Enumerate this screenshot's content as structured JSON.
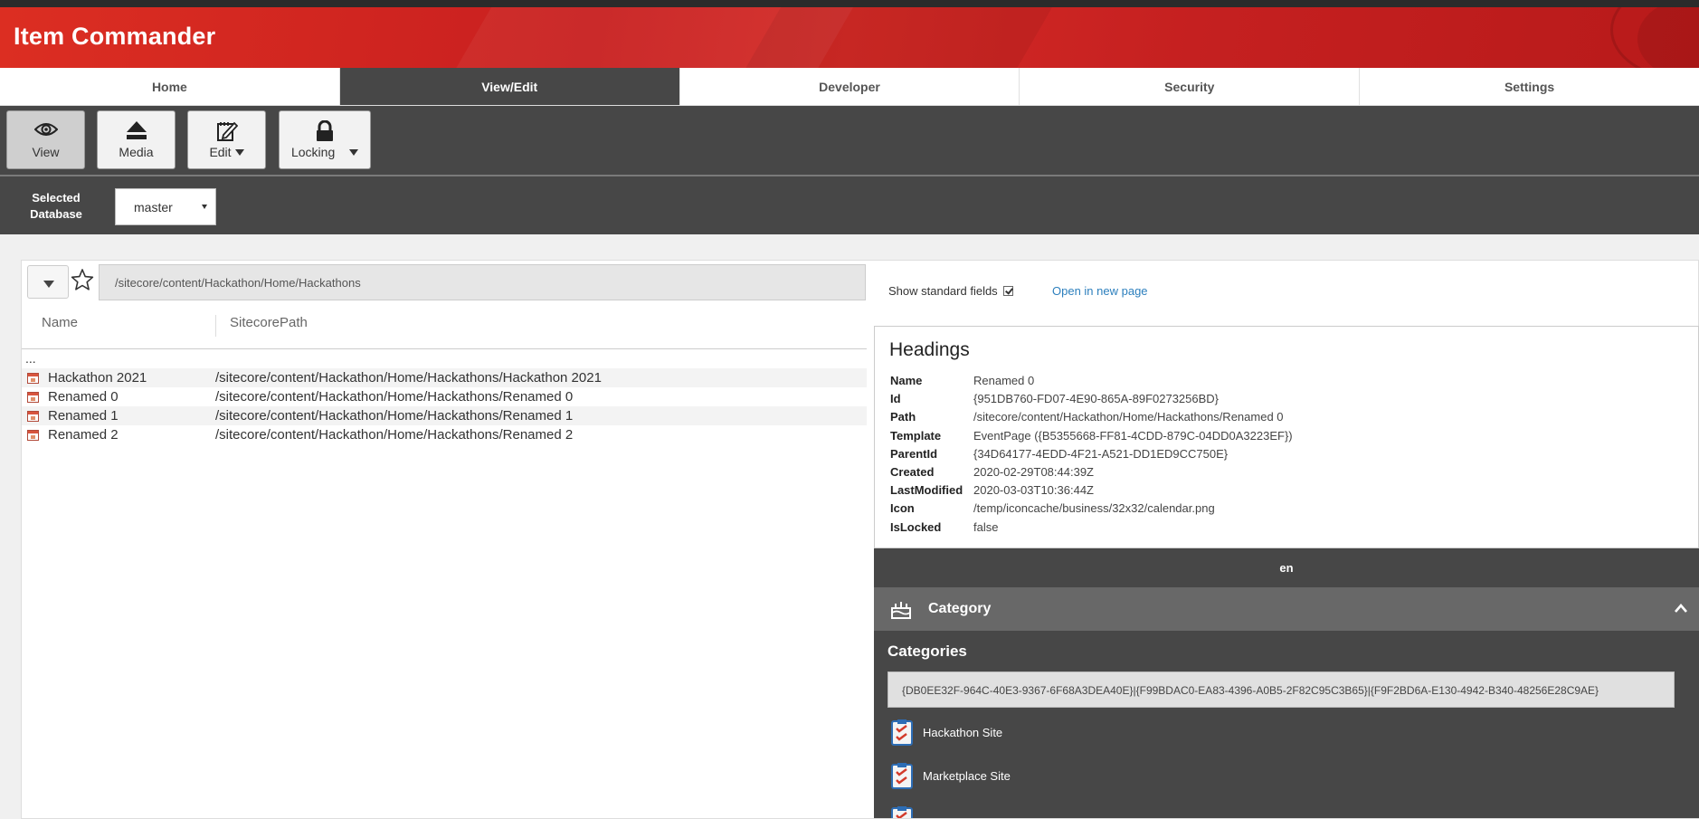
{
  "app": {
    "title": "Item Commander"
  },
  "tabs": [
    {
      "label": "Home"
    },
    {
      "label": "View/Edit"
    },
    {
      "label": "Developer"
    },
    {
      "label": "Security"
    },
    {
      "label": "Settings"
    }
  ],
  "active_tab": "View/Edit",
  "toolbar": {
    "view_label": "View",
    "media_label": "Media",
    "edit_label": "Edit",
    "locking_label": "Locking"
  },
  "database": {
    "label_line1": "Selected",
    "label_line2": "Database",
    "selected": "master"
  },
  "navigator": {
    "path": "/sitecore/content/Hackathon/Home/Hackathons",
    "columns": {
      "name": "Name",
      "path": "SitecorePath"
    },
    "parent_marker": "...",
    "items": [
      {
        "name": "Hackathon 2021",
        "path": "/sitecore/content/Hackathon/Home/Hackathons/Hackathon 2021"
      },
      {
        "name": "Renamed 0",
        "path": "/sitecore/content/Hackathon/Home/Hackathons/Renamed 0"
      },
      {
        "name": "Renamed 1",
        "path": "/sitecore/content/Hackathon/Home/Hackathons/Renamed 1"
      },
      {
        "name": "Renamed 2",
        "path": "/sitecore/content/Hackathon/Home/Hackathons/Renamed 2"
      }
    ]
  },
  "details": {
    "show_standard_fields_label": "Show standard fields",
    "show_standard_fields": true,
    "open_new_page": "Open in new page",
    "headings_title": "Headings",
    "properties": [
      {
        "key": "Name",
        "value": "Renamed 0"
      },
      {
        "key": "Id",
        "value": "{951DB760-FD07-4E90-865A-89F0273256BD}"
      },
      {
        "key": "Path",
        "value": "/sitecore/content/Hackathon/Home/Hackathons/Renamed 0"
      },
      {
        "key": "Template",
        "value": "EventPage ({B5355668-FF81-4CDD-879C-04DD0A3223EF})"
      },
      {
        "key": "ParentId",
        "value": "{34D64177-4EDD-4F21-A521-DD1ED9CC750E}"
      },
      {
        "key": "Created",
        "value": "2020-02-29T08:44:39Z"
      },
      {
        "key": "LastModified",
        "value": "2020-03-03T10:36:44Z"
      },
      {
        "key": "Icon",
        "value": "/temp/iconcache/business/32x32/calendar.png"
      },
      {
        "key": "IsLocked",
        "value": "false"
      }
    ],
    "language": "en",
    "section_title": "Category",
    "field_title": "Categories",
    "field_value": "{DB0EE32F-964C-40E3-9367-6F68A3DEA40E}|{F99BDAC0-EA83-4396-A0B5-2F82C95C3B65}|{F9F2BD6A-E130-4942-B340-48256E28C9AE}",
    "category_items": [
      {
        "label": "Hackathon Site"
      },
      {
        "label": "Marketplace Site"
      }
    ]
  },
  "colors": {
    "brand_red": "#d42a26",
    "toolbar_dark": "#474747",
    "link_blue": "#2c7fbd"
  }
}
